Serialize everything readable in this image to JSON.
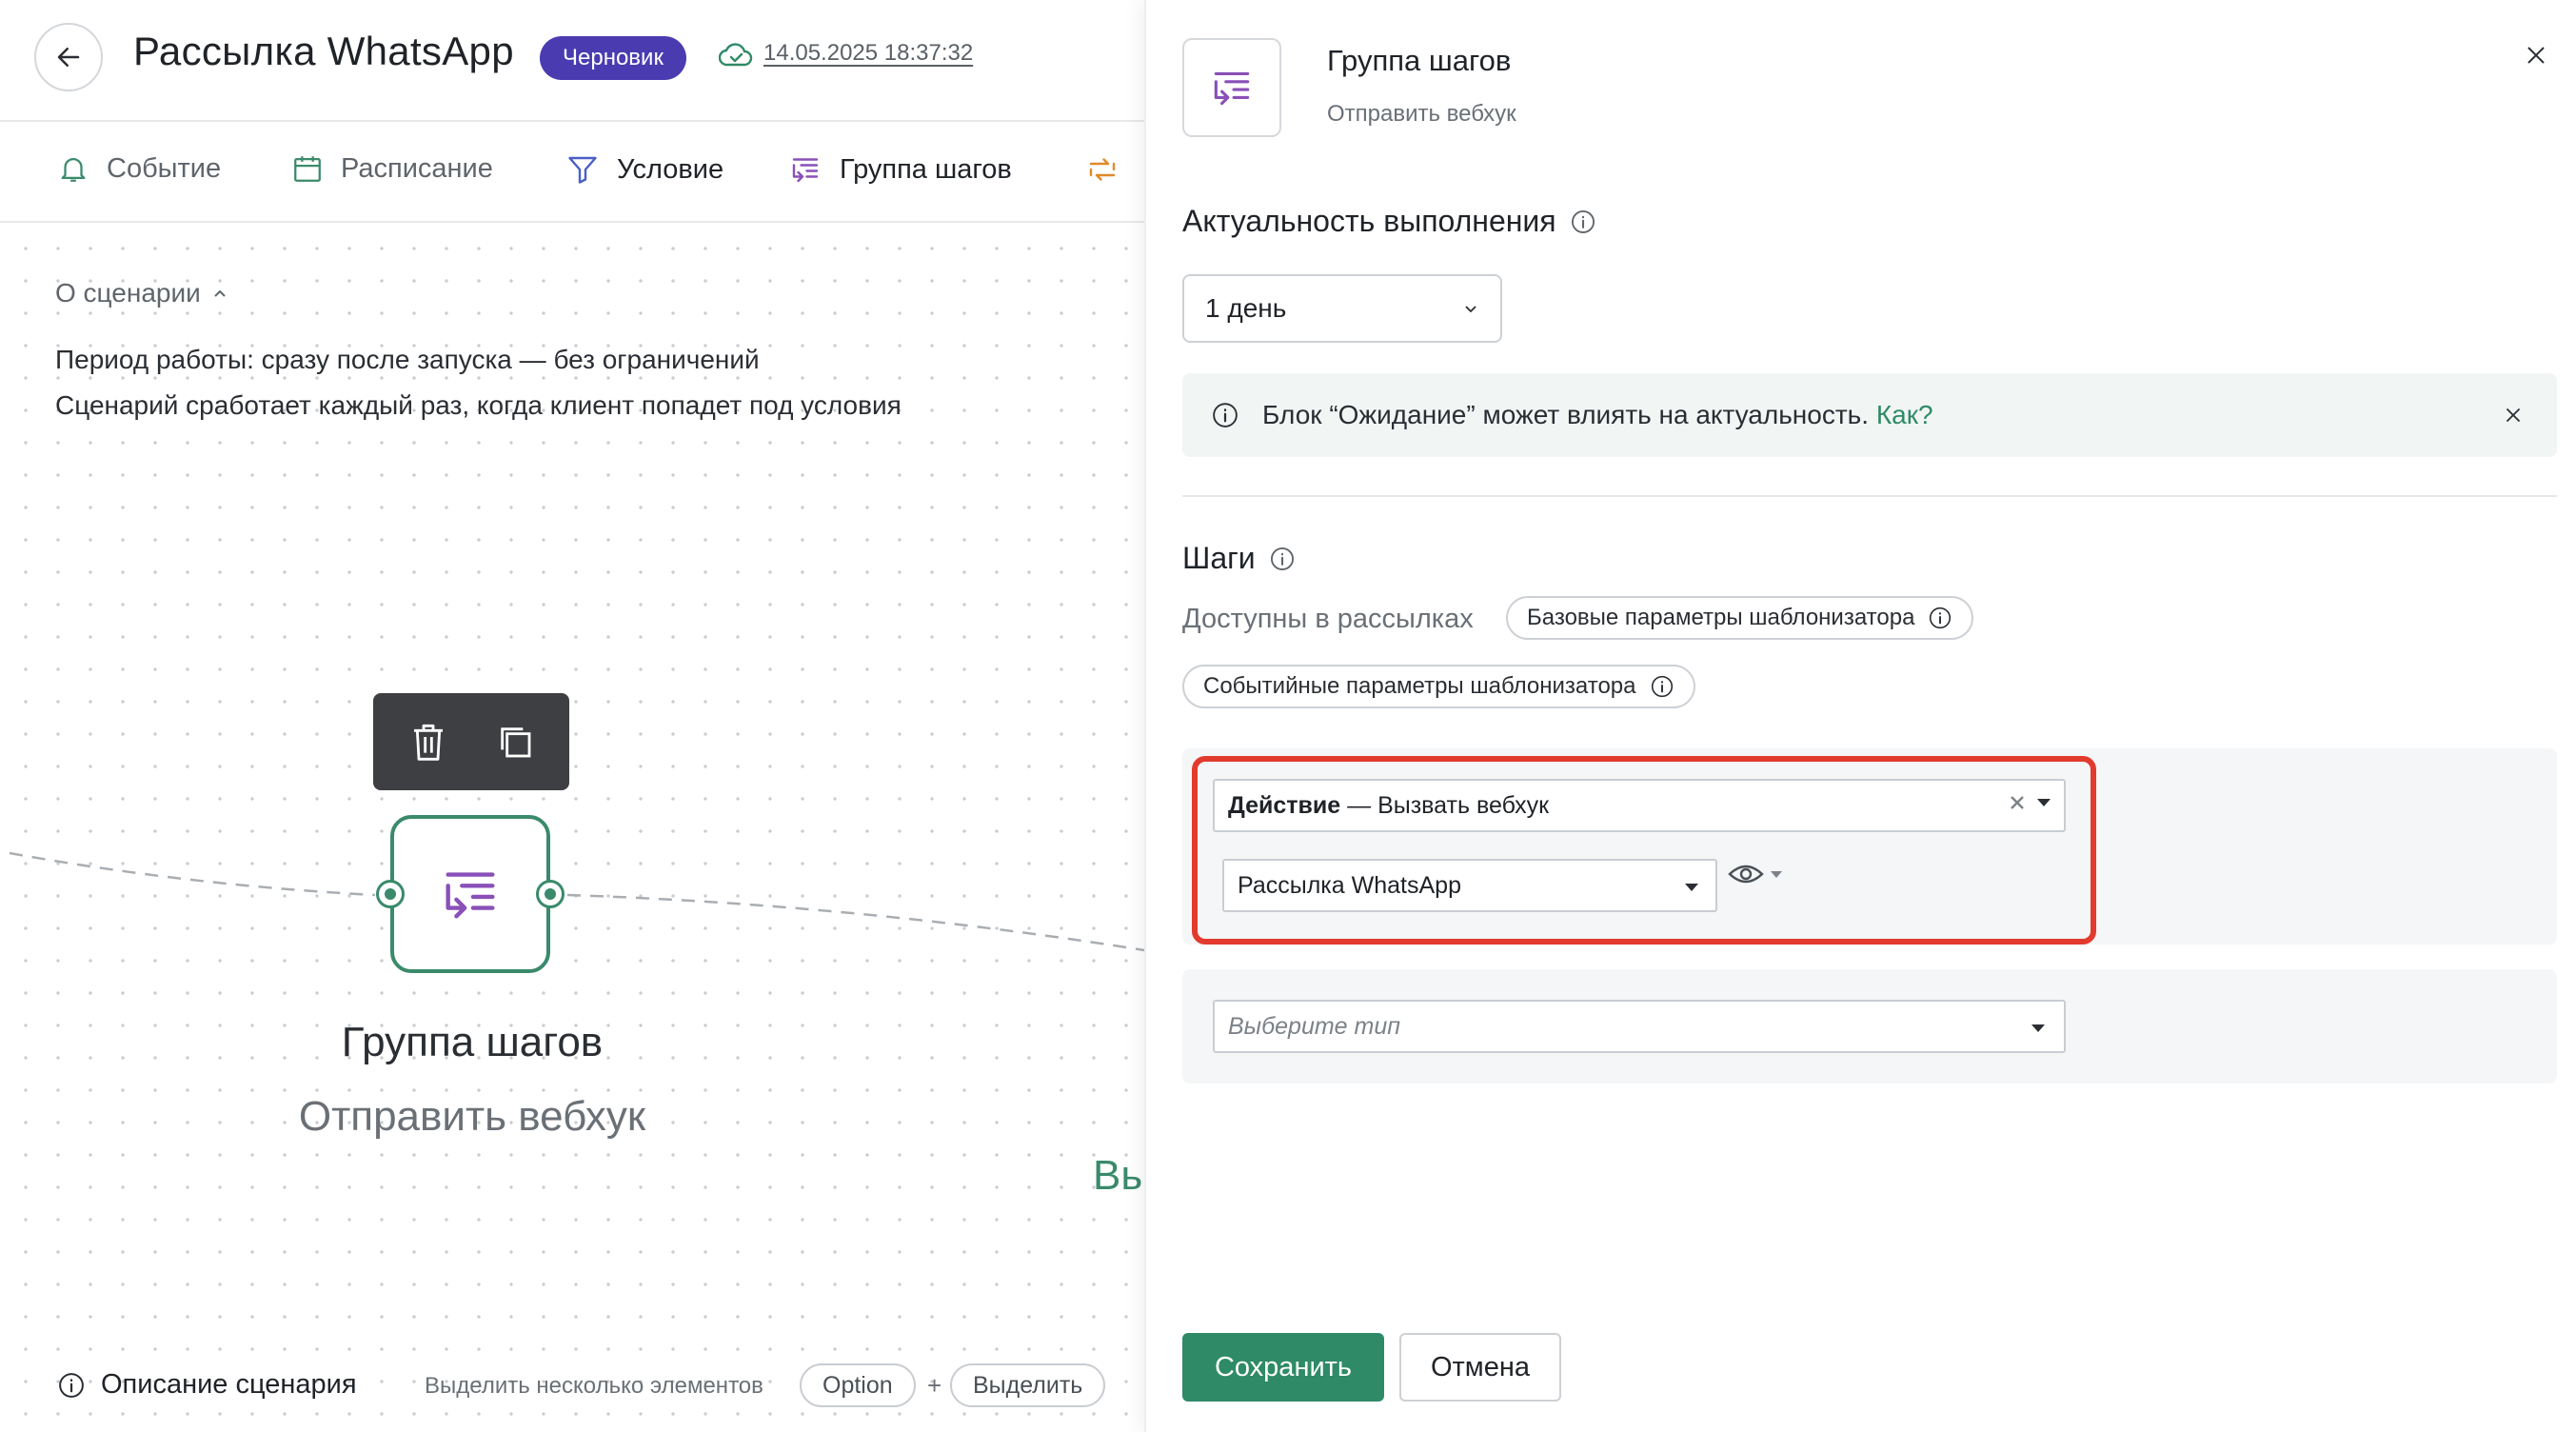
{
  "header": {
    "title": "Рассылка WhatsApp",
    "status_badge": "Черновик",
    "saved_time": "14.05.2025 18:37:32"
  },
  "tabs": [
    {
      "label": "Событие",
      "icon": "bell-icon"
    },
    {
      "label": "Расписание",
      "icon": "calendar-icon"
    },
    {
      "label": "Условие",
      "icon": "filter-icon"
    },
    {
      "label": "Группа шагов",
      "icon": "step-group-icon"
    }
  ],
  "about": {
    "toggle_label": "О сценарии",
    "line1": "Период работы: сразу после запуска — без ограничений",
    "line2": "Сценарий сработает каждый раз, когда клиент попадет под условия"
  },
  "node": {
    "title": "Группа шагов",
    "subtitle": "Отправить вебхук",
    "partial_label": "Вь"
  },
  "bottom": {
    "description_link": "Описание сценария",
    "multi_select_hint": "Выделить несколько элементов",
    "key_option": "Option",
    "plus": "+",
    "key_select": "Выделить"
  },
  "panel": {
    "title": "Группа шагов",
    "subtitle": "Отправить вебхук",
    "relevance_title": "Актуальность выполнения",
    "relevance_value": "1 день",
    "info_text": "Блок “Ожидание” может влиять на актуальность.",
    "info_link": "Как?",
    "steps_title": "Шаги",
    "available_label": "Доступны в рассылках",
    "chip_basic": "Базовые параметры шаблонизатора",
    "chip_event": "Событийные параметры шаблонизатора",
    "action_label": "Действие",
    "action_value": " — Вызвать вебхук",
    "mailing_value": "Рассылка WhatsApp",
    "type_placeholder": "Выберите тип",
    "save_label": "Сохранить",
    "cancel_label": "Отмена"
  },
  "colors": {
    "accent_green": "#2f8a67",
    "badge_purple": "#4a3bb0",
    "highlight_red": "#e23b2e",
    "icon_purple": "#8a4fb8"
  }
}
